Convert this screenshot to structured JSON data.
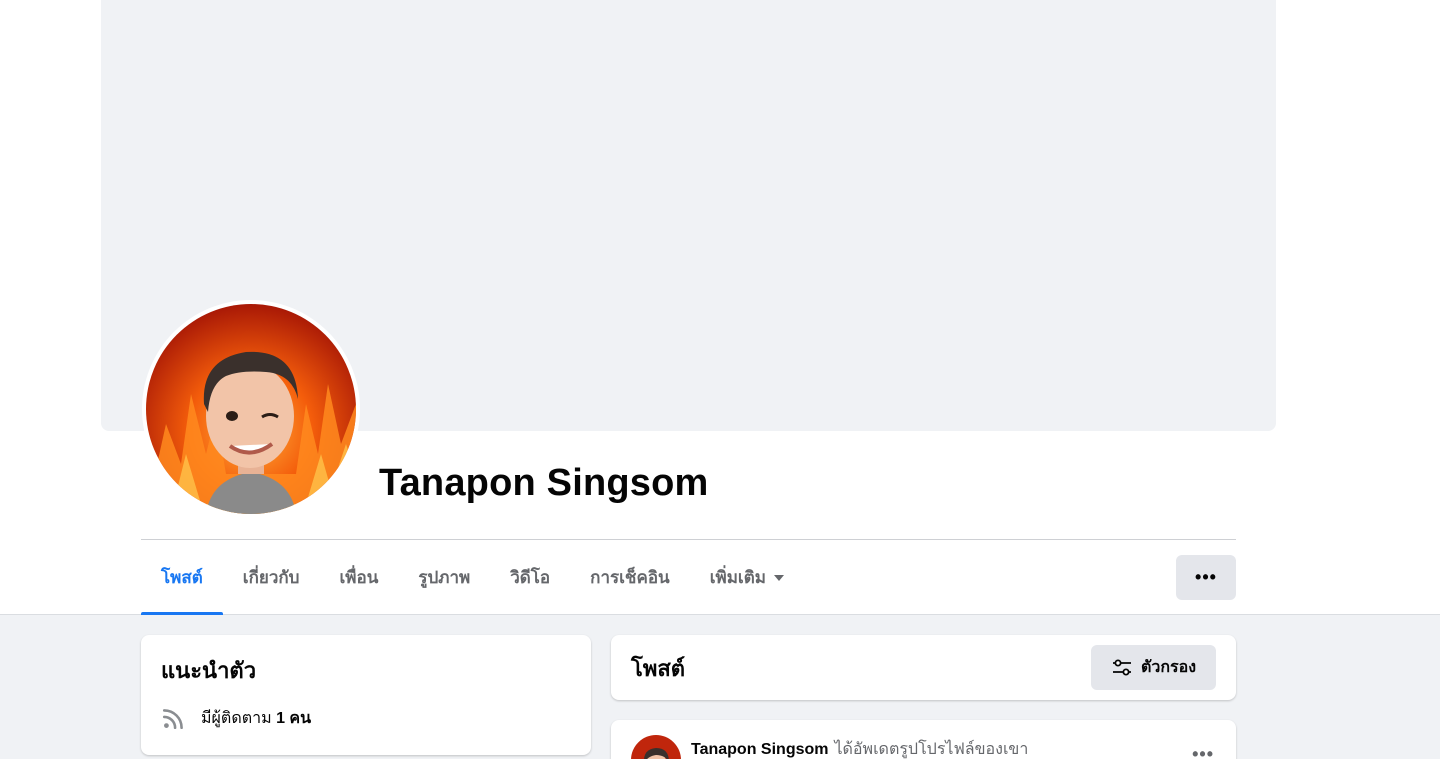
{
  "profile": {
    "name": "Tanapon Singsom"
  },
  "tabs": [
    {
      "label": "โพสต์",
      "active": true
    },
    {
      "label": "เกี่ยวกับ",
      "active": false
    },
    {
      "label": "เพื่อน",
      "active": false
    },
    {
      "label": "รูปภาพ",
      "active": false
    },
    {
      "label": "วิดีโอ",
      "active": false
    },
    {
      "label": "การเช็คอิน",
      "active": false
    },
    {
      "label": "เพิ่มเติม",
      "active": false
    }
  ],
  "more_button": {
    "label": "•••"
  },
  "intro": {
    "title": "แนะนำตัว",
    "followers_prefix": "มีผู้ติดตาม",
    "followers_count": "1 คน"
  },
  "posts": {
    "title": "โพสต์",
    "filter_label": "ตัวกรอง"
  },
  "post": {
    "author": "Tanapon Singsom",
    "action": "ได้อัพเดตรูปโปรไฟล์ของเขา",
    "menu": "•••"
  },
  "colors": {
    "accent": "#1877f2",
    "background": "#f0f2f5",
    "button": "#e4e6eb"
  },
  "icons": {
    "more": "dots-icon",
    "caret": "caret-down-icon",
    "followers": "rss-icon",
    "filter": "filter-sliders-icon"
  }
}
